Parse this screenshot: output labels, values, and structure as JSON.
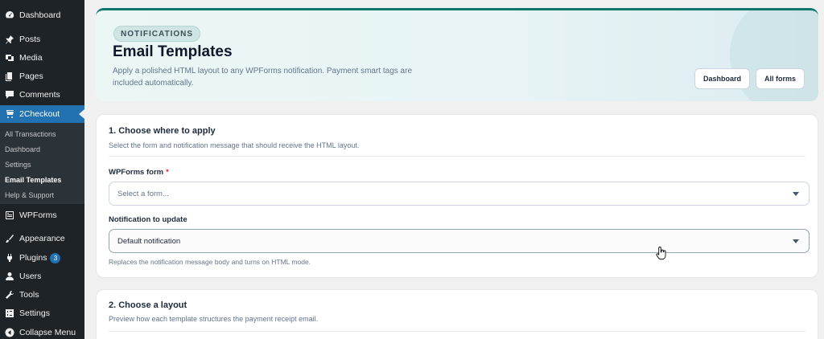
{
  "sidebar": {
    "items": [
      {
        "label": "Dashboard",
        "icon": "dashboard-icon"
      },
      {
        "label": "Posts",
        "icon": "pin-icon"
      },
      {
        "label": "Media",
        "icon": "media-icon"
      },
      {
        "label": "Pages",
        "icon": "pages-icon"
      },
      {
        "label": "Comments",
        "icon": "comment-icon"
      },
      {
        "label": "2Checkout",
        "icon": "cart-icon"
      },
      {
        "label": "WPForms",
        "icon": "wpforms-icon"
      },
      {
        "label": "Appearance",
        "icon": "brush-icon"
      },
      {
        "label": "Plugins",
        "icon": "plugin-icon",
        "badge": "3"
      },
      {
        "label": "Users",
        "icon": "user-icon"
      },
      {
        "label": "Tools",
        "icon": "wrench-icon"
      },
      {
        "label": "Settings",
        "icon": "settings-icon"
      },
      {
        "label": "Collapse Menu",
        "icon": "collapse-icon"
      }
    ],
    "submenu": [
      "All Transactions",
      "Dashboard",
      "Settings",
      "Email Templates",
      "Help & Support"
    ]
  },
  "hero": {
    "chip": "NOTIFICATIONS",
    "title": "Email Templates",
    "description": "Apply a polished HTML layout to any WPForms notification. Payment smart tags are included automatically.",
    "buttons": [
      "Dashboard",
      "All forms"
    ]
  },
  "section1": {
    "title": "1. Choose where to apply",
    "subtitle": "Select the form and notification message that should receive the HTML layout.",
    "form_label": "WPForms form",
    "required_mark": "*",
    "form_placeholder": "Select a form...",
    "notification_label": "Notification to update",
    "notification_value": "Default notification",
    "help": "Replaces the notification message body and turns on HTML mode."
  },
  "section2": {
    "title": "2. Choose a layout",
    "subtitle": "Preview how each template structures the payment receipt email."
  },
  "colors": {
    "sidebar_bg": "#1d2327",
    "active": "#2271b1",
    "accent": "#0f766e"
  }
}
